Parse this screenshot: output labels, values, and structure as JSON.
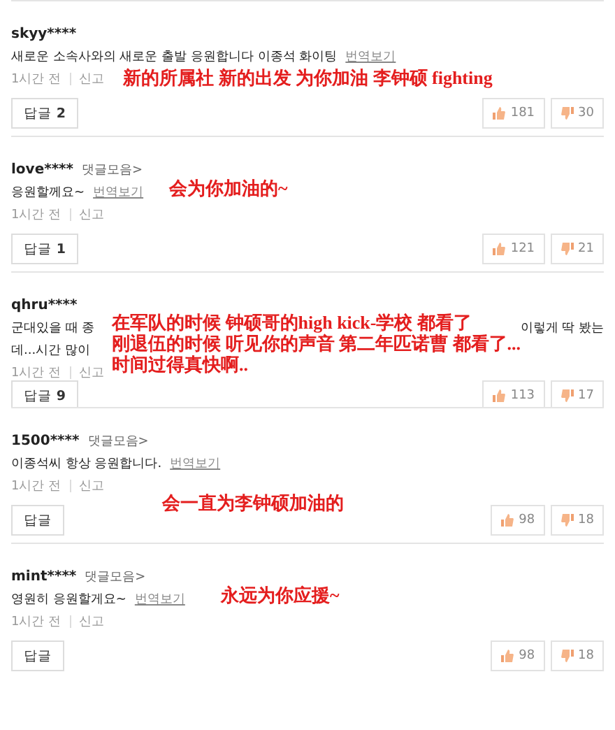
{
  "comments": [
    {
      "user": "skyy****",
      "body": [
        "새로운 소속사와의 새로운 출발 응원합니다 이종석 화이팅"
      ],
      "translate": "번역보기",
      "time": "1시간 전",
      "report": "신고",
      "reply": {
        "label": "답글",
        "count": "2"
      },
      "likes": "181",
      "dislikes": "30",
      "annotation": [
        "新的所属社 新的出发 为你加油 李钟硕 fighting"
      ]
    },
    {
      "user": "love****",
      "collection": "댓글모음>",
      "body": [
        "응원할께요~"
      ],
      "translate": "번역보기",
      "time": "1시간 전",
      "report": "신고",
      "reply": {
        "label": "답글",
        "count": "1"
      },
      "likes": "121",
      "dislikes": "21",
      "annotation": [
        "会为你加油的~"
      ]
    },
    {
      "user": "qhru****",
      "body": [
        "군대있을 때 종",
        "이렇게 딱 봤는",
        "데...시간 많이"
      ],
      "time": "1시간 전",
      "report": "신고",
      "reply": {
        "label": "답글",
        "count": "9"
      },
      "likes": "113",
      "dislikes": "17",
      "annotation": [
        "在军队的时候 钟硕哥的high kick-学校 都看了",
        "刚退伍的时候 听见你的声音 第二年匹诺曹 都看了...",
        "时间过得真快啊.."
      ]
    },
    {
      "user": "1500****",
      "collection": "댓글모음>",
      "body": [
        "이종석씨 항상 응원합니다."
      ],
      "translate": "번역보기",
      "time": "1시간 전",
      "report": "신고",
      "reply": {
        "label": "답글"
      },
      "likes": "98",
      "dislikes": "18",
      "annotation": [
        "会一直为李钟硕加油的"
      ]
    },
    {
      "user": "mint****",
      "collection": "댓글모음>",
      "body": [
        "영원히 응원할게요~"
      ],
      "translate": "번역보기",
      "time": "1시간 전",
      "report": "신고",
      "reply": {
        "label": "답글"
      },
      "likes": "98",
      "dislikes": "18",
      "annotation": [
        "永远为你应援~"
      ]
    }
  ]
}
